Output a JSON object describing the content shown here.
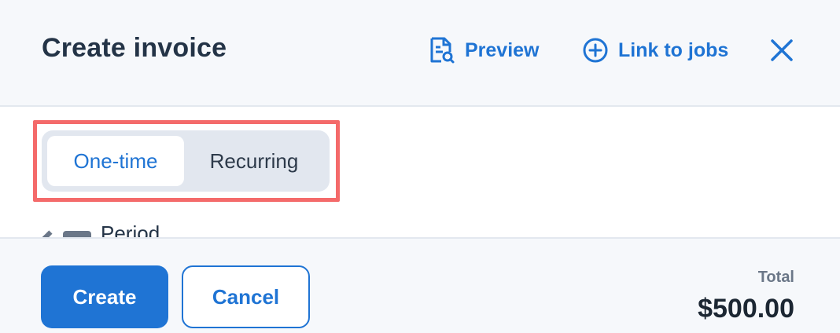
{
  "header": {
    "title": "Create invoice",
    "preview_label": "Preview",
    "link_jobs_label": "Link to jobs"
  },
  "invoice_type": {
    "options": [
      {
        "label": "One-time",
        "selected": true
      },
      {
        "label": "Recurring",
        "selected": false
      }
    ]
  },
  "peek": {
    "label": "Period"
  },
  "footer": {
    "create_label": "Create",
    "cancel_label": "Cancel",
    "total_label": "Total",
    "total_value": "$500.00"
  },
  "colors": {
    "accent": "#1f74d4",
    "highlight": "#f46a6a",
    "header_bg": "#f6f8fb"
  }
}
